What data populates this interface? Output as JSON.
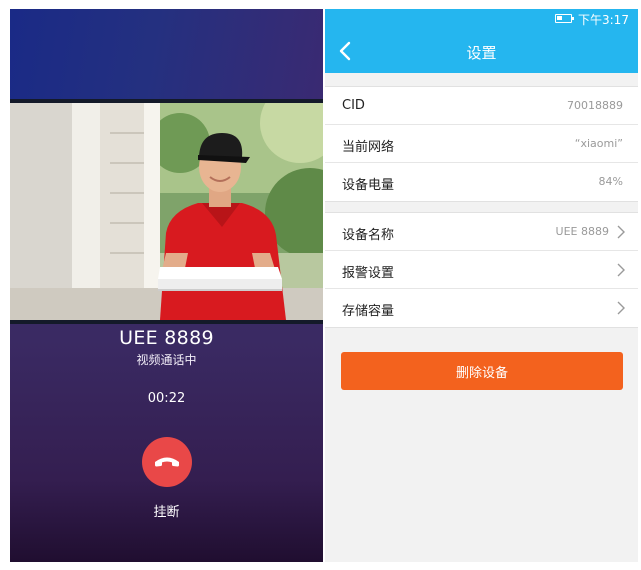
{
  "call": {
    "caller_name": "UEE 8889",
    "status_text": "视频通话中",
    "timer": "00:22",
    "hangup_label": "挂断",
    "hangup_color": "#e94848"
  },
  "settings": {
    "status_bar": {
      "time": "下午3:17",
      "battery_icon": "battery-low-icon"
    },
    "nav": {
      "back_icon": "chevron-left-icon",
      "title": "设置",
      "bar_color": "#25b6ef"
    },
    "info_rows": [
      {
        "label": "CID",
        "value": "70018889"
      },
      {
        "label": "当前网络",
        "value": "“xiaomi”"
      },
      {
        "label": "设备电量",
        "value": "84%"
      }
    ],
    "setting_rows": [
      {
        "label": "设备名称",
        "value": "UEE 8889",
        "icon": "chevron-right-icon"
      },
      {
        "label": "报警设置",
        "value": "",
        "icon": "chevron-right-icon"
      },
      {
        "label": "存储容量",
        "value": "",
        "icon": "chevron-right-icon"
      }
    ],
    "delete_button": {
      "label": "删除设备",
      "color": "#f3621e"
    }
  }
}
